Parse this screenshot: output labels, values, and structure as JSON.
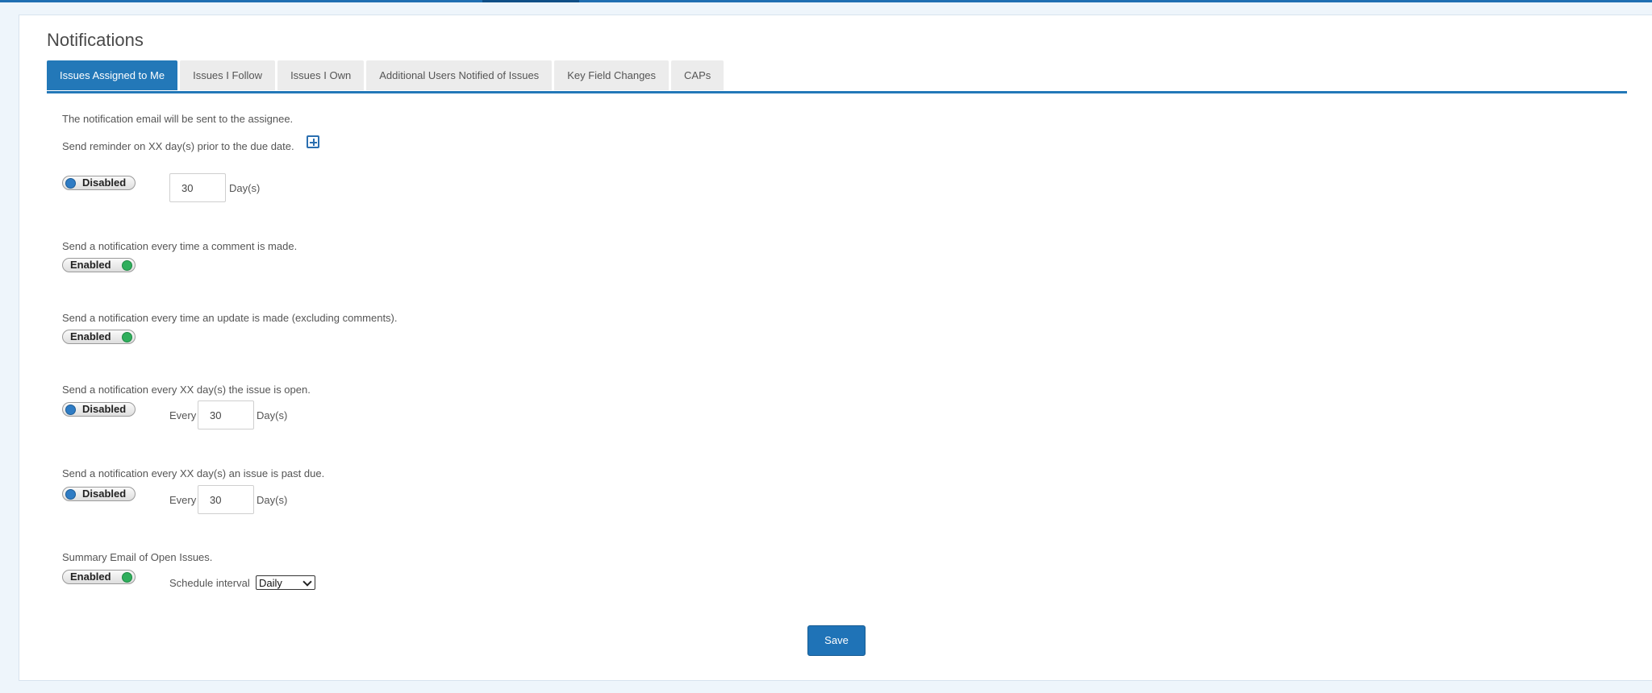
{
  "page": {
    "title": "Notifications"
  },
  "tabs": [
    {
      "label": "Issues Assigned to Me",
      "active": true
    },
    {
      "label": "Issues I Follow",
      "active": false
    },
    {
      "label": "Issues I Own",
      "active": false
    },
    {
      "label": "Additional Users Notified of Issues",
      "active": false
    },
    {
      "label": "Key Field Changes",
      "active": false
    },
    {
      "label": "CAPs",
      "active": false
    }
  ],
  "intro": "The notification email will be sent to the assignee.",
  "reminder": {
    "description": "Send reminder on XX day(s) prior to the due date.",
    "toggle": "Disabled",
    "days": "30",
    "unit": "Day(s)",
    "add_icon": "plus-square-icon"
  },
  "comment": {
    "description": "Send a notification every time a comment is made.",
    "toggle": "Enabled"
  },
  "update": {
    "description": "Send a notification every time an update is made (excluding comments).",
    "toggle": "Enabled"
  },
  "open_issue": {
    "description": "Send a notification every XX day(s) the issue is open.",
    "toggle": "Disabled",
    "prefix": "Every",
    "days": "30",
    "unit": "Day(s)"
  },
  "past_due": {
    "description": "Send a notification every XX day(s) an issue is past due.",
    "toggle": "Disabled",
    "prefix": "Every",
    "days": "30",
    "unit": "Day(s)"
  },
  "summary": {
    "description": "Summary Email of Open Issues.",
    "toggle": "Enabled",
    "interval_label": "Schedule interval",
    "interval_value": "Daily"
  },
  "actions": {
    "save_label": "Save"
  },
  "colors": {
    "accent": "#2378b8",
    "enabled_knob": "#2fae5c",
    "disabled_knob": "#2f7cc4"
  }
}
